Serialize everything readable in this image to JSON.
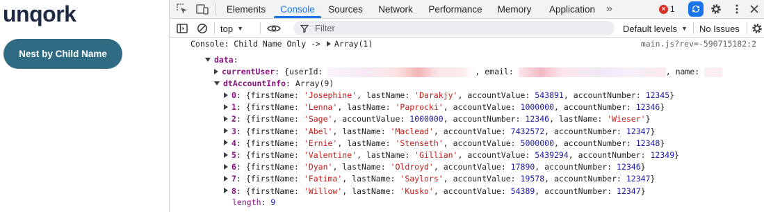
{
  "app": {
    "logo_text": "unqork",
    "nest_button_label": "Nest by Child Name"
  },
  "devtools": {
    "tabs": [
      {
        "label": "Elements"
      },
      {
        "label": "Console",
        "active": true
      },
      {
        "label": "Sources"
      },
      {
        "label": "Network"
      },
      {
        "label": "Performance"
      },
      {
        "label": "Memory"
      },
      {
        "label": "Application"
      }
    ],
    "more_tabs_glyph": "»",
    "error_count": "1",
    "error_glyph": "×",
    "toolbar": {
      "context": "top",
      "filter_placeholder": "Filter",
      "levels": "Default levels",
      "issues": "No Issues"
    },
    "colors": {
      "accent": "#1a73e8",
      "error": "#d93025",
      "key": "#881280",
      "string": "#c41a16",
      "number": "#1a1aa6"
    }
  },
  "console": {
    "log_prefix": "Console: Child Name Only -> ",
    "log_summary": "Array(1)",
    "source": "main.js?rev=-590715182:2",
    "data_key": "data",
    "current_user": {
      "key": "currentUser",
      "userId_key": "userId",
      "email_key": "email",
      "name_key": "name"
    },
    "dt_account_info": {
      "key": "dtAccountInfo",
      "summary": "Array(9)",
      "items": [
        {
          "index": "0",
          "fields": [
            [
              "firstName",
              "'Josephine'",
              "s"
            ],
            [
              "lastName",
              "'Darakjy'",
              "s"
            ],
            [
              "accountValue",
              "543891",
              "n"
            ],
            [
              "accountNumber",
              "12345",
              "n"
            ]
          ]
        },
        {
          "index": "1",
          "fields": [
            [
              "firstName",
              "'Lenna'",
              "s"
            ],
            [
              "lastName",
              "'Paprocki'",
              "s"
            ],
            [
              "accountValue",
              "1000000",
              "n"
            ],
            [
              "accountNumber",
              "12346",
              "n"
            ]
          ]
        },
        {
          "index": "2",
          "fields": [
            [
              "firstName",
              "'Sage'",
              "s"
            ],
            [
              "accountValue",
              "1000000",
              "n"
            ],
            [
              "accountNumber",
              "12346",
              "n"
            ],
            [
              "lastName",
              "'Wieser'",
              "s"
            ]
          ]
        },
        {
          "index": "3",
          "fields": [
            [
              "firstName",
              "'Abel'",
              "s"
            ],
            [
              "lastName",
              "'Maclead'",
              "s"
            ],
            [
              "accountValue",
              "7432572",
              "n"
            ],
            [
              "accountNumber",
              "12347",
              "n"
            ]
          ]
        },
        {
          "index": "4",
          "fields": [
            [
              "firstName",
              "'Ernie'",
              "s"
            ],
            [
              "lastName",
              "'Stenseth'",
              "s"
            ],
            [
              "accountValue",
              "5000000",
              "n"
            ],
            [
              "accountNumber",
              "12348",
              "n"
            ]
          ]
        },
        {
          "index": "5",
          "fields": [
            [
              "firstName",
              "'Valentine'",
              "s"
            ],
            [
              "lastName",
              "'Gillian'",
              "s"
            ],
            [
              "accountValue",
              "5439294",
              "n"
            ],
            [
              "accountNumber",
              "12349",
              "n"
            ]
          ]
        },
        {
          "index": "6",
          "fields": [
            [
              "firstName",
              "'Dyan'",
              "s"
            ],
            [
              "lastName",
              "'Oldroyd'",
              "s"
            ],
            [
              "accountValue",
              "17890",
              "n"
            ],
            [
              "accountNumber",
              "12346",
              "n"
            ]
          ]
        },
        {
          "index": "7",
          "fields": [
            [
              "firstName",
              "'Fatima'",
              "s"
            ],
            [
              "lastName",
              "'Saylors'",
              "s"
            ],
            [
              "accountValue",
              "19578",
              "n"
            ],
            [
              "accountNumber",
              "12347",
              "n"
            ]
          ]
        },
        {
          "index": "8",
          "fields": [
            [
              "firstName",
              "'Willow'",
              "s"
            ],
            [
              "lastName",
              "'Kusko'",
              "s"
            ],
            [
              "accountValue",
              "54389",
              "n"
            ],
            [
              "accountNumber",
              "12347",
              "n"
            ]
          ]
        }
      ],
      "length_key": "length",
      "length_value": "9"
    }
  }
}
